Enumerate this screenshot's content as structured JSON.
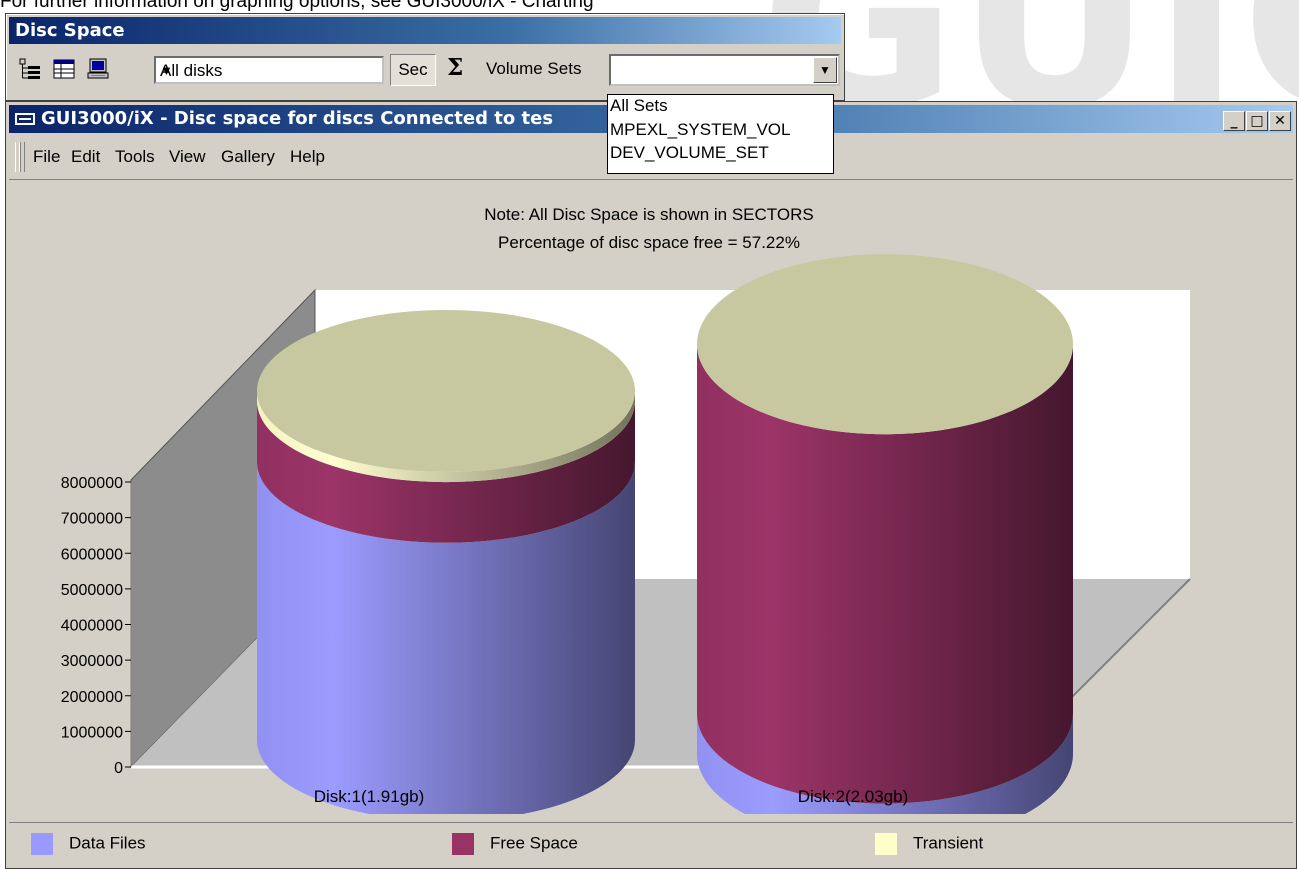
{
  "page": {
    "caption": "For further information on graphing options, see GUI3000/iX - Charting",
    "watermark": "GUIC"
  },
  "toolbar": {
    "title": "Disc Space",
    "icons": [
      "tree-icon",
      "grid-icon",
      "monitor-icon"
    ],
    "disk_select_value": "All disks",
    "sec_label": "Sec",
    "sum_label": "Σ",
    "volume_sets_label": "Volume Sets",
    "volume_sets_value": "",
    "volume_sets_options": [
      "All Sets",
      "MPEXL_SYSTEM_VOL",
      "DEV_VOLUME_SET"
    ]
  },
  "window": {
    "title": "GUI3000/iX - Disc space for discs Connected to tes"
  },
  "menu": {
    "file": "File",
    "edit": "Edit",
    "tools": "Tools",
    "view": "View",
    "gallery": "Gallery",
    "help": "Help"
  },
  "chart_data": {
    "type": "bar",
    "subtitle_lines": [
      "Note: All Disc Space is shown in SECTORS",
      "Percentage of disc space free = 57.22%"
    ],
    "categories": [
      "Disk:1(1.91gb)",
      "Disk:2(2.03gb)"
    ],
    "series": [
      {
        "name": "Data Files",
        "values": [
          5500000,
          800000
        ],
        "color": "#9999ff"
      },
      {
        "name": "Free Space",
        "values": [
          1200000,
          7300000
        ],
        "color": "#993366"
      },
      {
        "name": "Transient",
        "values": [
          200000,
          0
        ],
        "color": "#ffffcc"
      }
    ],
    "ylim": [
      0,
      8000000
    ],
    "yticks": [
      "0",
      "1000000",
      "2000000",
      "3000000",
      "4000000",
      "5000000",
      "6000000",
      "7000000",
      "8000000"
    ],
    "grid": false,
    "legend": "bottom"
  }
}
